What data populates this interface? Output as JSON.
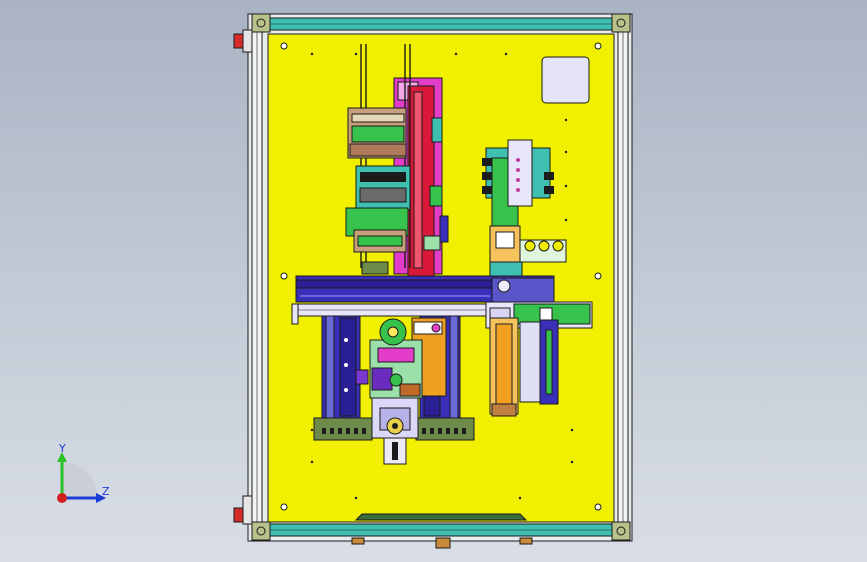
{
  "viewport": {
    "background_top": "#a9b3c3",
    "background_bottom": "#d9dee6"
  },
  "colors": {
    "plate": "#f0f000",
    "frame_teal": "#3fbfb0",
    "frame_rail": "#f3f4f4",
    "outline": "#1b1b1b",
    "magenta": "#e23cc8",
    "red_arm": "#d9183a",
    "blue_rail": "#3a2fb8",
    "purple_block": "#6a2bbf",
    "green_cyl": "#37c24c",
    "orange_part": "#f0a020",
    "mint_part": "#9ae0a8",
    "olive_block": "#6f8b4a",
    "lavender_pad": "#e8e6fb",
    "navy_strip": "#20309a"
  },
  "triad": {
    "y_label": "Y",
    "z_label": "Z",
    "y_color": "#29c229",
    "z_color": "#1a3bd6",
    "x_color": "#d11f1f"
  }
}
